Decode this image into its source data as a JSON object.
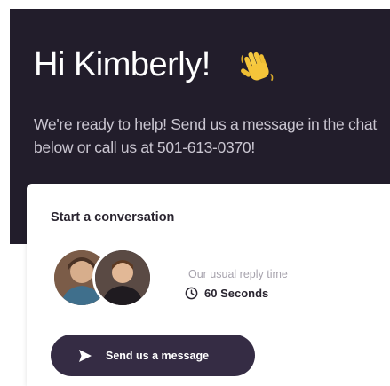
{
  "header": {
    "greeting": "Hi Kimberly!",
    "wave_icon": "waving-hand-icon",
    "intro_text": "We're ready to help! Send us a message in the chat below or call us at 501-613-0370!"
  },
  "card": {
    "title": "Start a conversation",
    "reply_label": "Our usual reply time",
    "reply_time": "60 Seconds",
    "clock_icon": "clock-icon",
    "send_button_label": "Send us a message",
    "send_icon": "send-icon"
  },
  "colors": {
    "header_bg": "#221d2b",
    "button_bg": "#352c44",
    "muted_text": "#a7a3ad"
  }
}
